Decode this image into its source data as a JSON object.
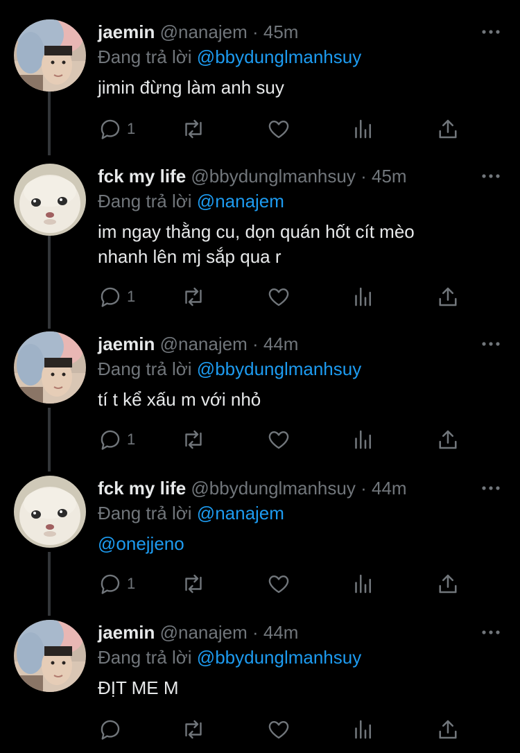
{
  "tweets": [
    {
      "name": "jaemin",
      "handle": "@nanajem",
      "dot": "·",
      "time": "45m",
      "reply_prefix": "Đang trả lời",
      "reply_to": "@bbydunglmanhsuy",
      "text": "jimin đừng làm anh suy",
      "reply_count": "1",
      "avatar": "jaemin-avatar"
    },
    {
      "name": "fck my life",
      "handle": "@bbydunglmanhsuy",
      "dot": "·",
      "time": "45m",
      "reply_prefix": "Đang trả lời",
      "reply_to": "@nanajem",
      "text_line1": "im ngay thằng cu, dọn quán hốt cít mèo",
      "text_line2": "nhanh lên mj sắp qua r",
      "reply_count": "1",
      "avatar": "cat-avatar"
    },
    {
      "name": "jaemin",
      "handle": "@nanajem",
      "dot": "·",
      "time": "44m",
      "reply_prefix": "Đang trả lời",
      "reply_to": "@bbydunglmanhsuy",
      "text": "tí t kể xấu m với nhỏ",
      "reply_count": "1",
      "avatar": "jaemin-avatar"
    },
    {
      "name": "fck my life",
      "handle": "@bbydunglmanhsuy",
      "dot": "·",
      "time": "44m",
      "reply_prefix": "Đang trả lời",
      "reply_to": "@nanajem",
      "text": "@onejjeno",
      "reply_count": "1",
      "avatar": "cat-avatar"
    },
    {
      "name": "jaemin",
      "handle": "@nanajem",
      "dot": "·",
      "time": "44m",
      "reply_prefix": "Đang trả lời",
      "reply_to": "@bbydunglmanhsuy",
      "text": "ĐỊT ME M",
      "reply_count": "",
      "avatar": "jaemin-avatar"
    }
  ],
  "icons": {
    "reply": "reply-icon",
    "retweet": "retweet-icon",
    "like": "heart-icon",
    "views": "views-icon",
    "share": "share-icon",
    "more": "more-icon"
  },
  "colors": {
    "background": "#000000",
    "text": "#e7e9ea",
    "muted": "#71767b",
    "accent": "#1d9bf0",
    "thread_line": "#333639"
  }
}
